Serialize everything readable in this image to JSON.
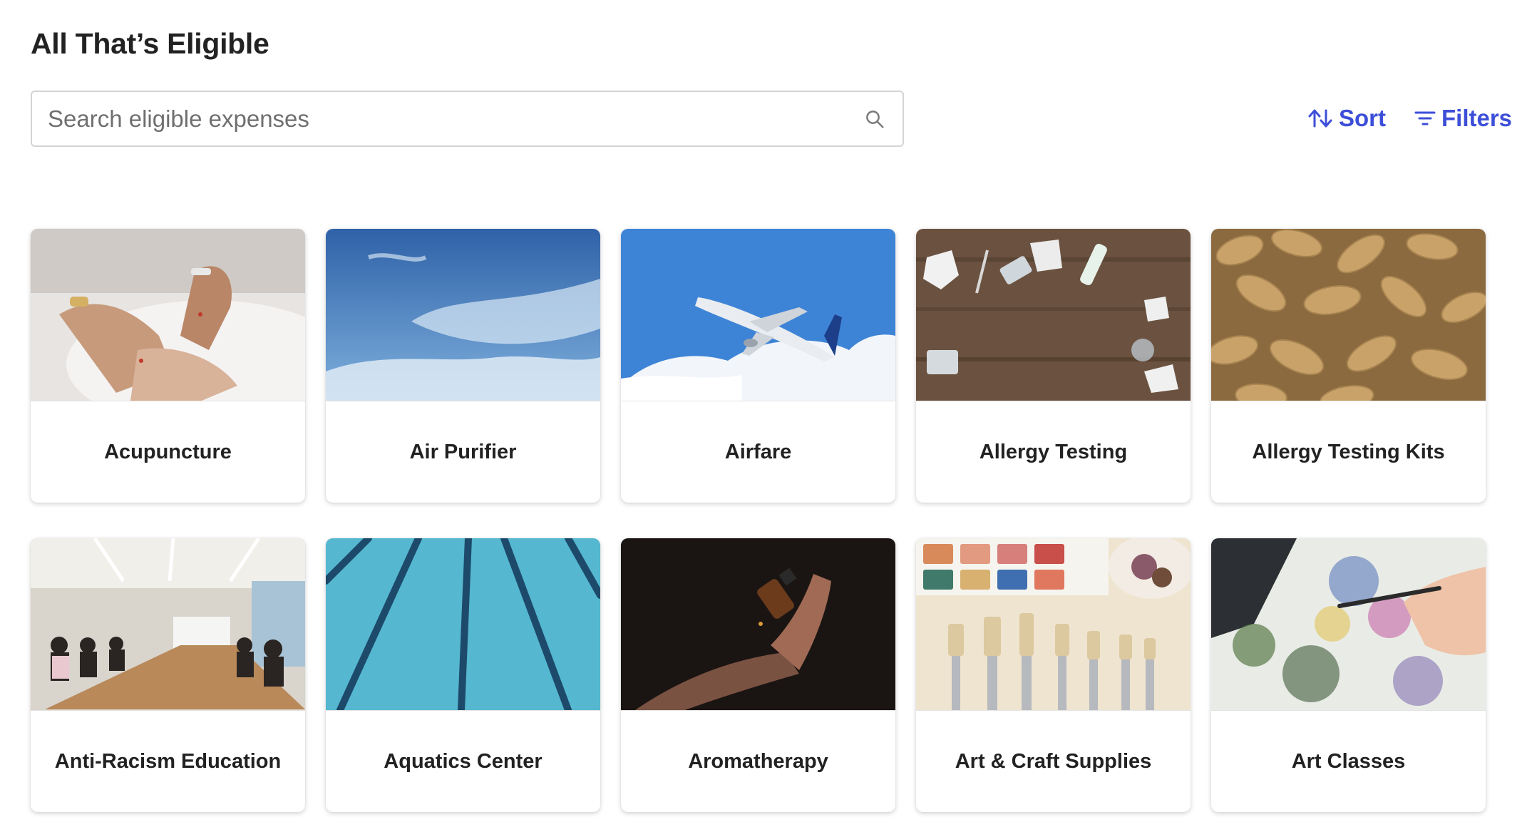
{
  "header": {
    "title": "All That’s Eligible"
  },
  "search": {
    "placeholder": "Search eligible expenses",
    "icon": "search-icon"
  },
  "toolbar": {
    "sort_label": "Sort",
    "filters_label": "Filters",
    "accent": "#3d4fd8"
  },
  "cards": [
    {
      "label": "Acupuncture",
      "image": "acupuncture-photo"
    },
    {
      "label": "Air Purifier",
      "image": "sky-photo"
    },
    {
      "label": "Airfare",
      "image": "airplane-photo"
    },
    {
      "label": "Allergy Testing",
      "image": "allergy-testing-photo"
    },
    {
      "label": "Allergy Testing Kits",
      "image": "peanuts-photo"
    },
    {
      "label": "Anti-Racism Education",
      "image": "conference-room-photo"
    },
    {
      "label": "Aquatics Center",
      "image": "swimming-pool-photo"
    },
    {
      "label": "Aromatherapy",
      "image": "essential-oil-photo"
    },
    {
      "label": "Art & Craft Supplies",
      "image": "paints-brushes-photo"
    },
    {
      "label": "Art Classes",
      "image": "watercolor-painting-photo"
    }
  ]
}
